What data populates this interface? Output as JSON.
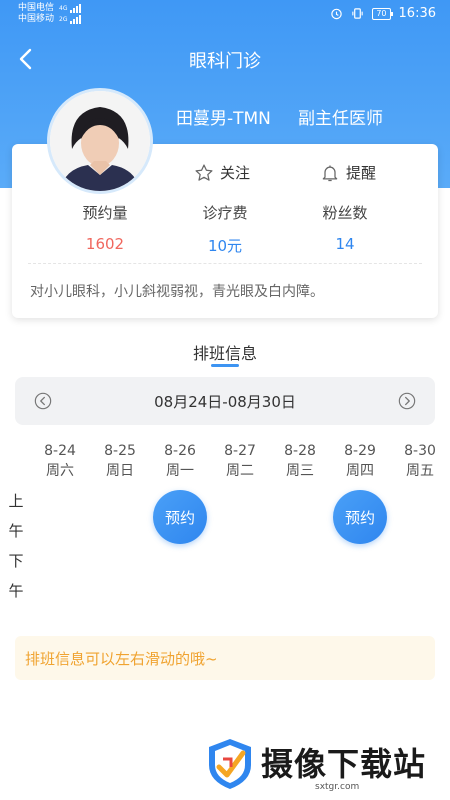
{
  "status_bar": {
    "carrier1": "中国电信",
    "carrier1_net": "4G",
    "carrier2": "中国移动",
    "carrier2_net": "2G",
    "battery": "70",
    "time": "16:36"
  },
  "nav": {
    "title": "眼科门诊",
    "back_icon": "chevron-left-icon"
  },
  "doctor": {
    "name": "田蔓男-TMN",
    "title": "副主任医师",
    "follow_label": "关注",
    "remind_label": "提醒",
    "stats": [
      {
        "label": "预约量",
        "value": "1602",
        "color": "#f0675e"
      },
      {
        "label": "诊疗费",
        "value": "10元",
        "color": "#2f86ef"
      },
      {
        "label": "粉丝数",
        "value": "14",
        "color": "#2f86ef"
      }
    ],
    "description": "对小儿眼科，小儿斜视弱视，青光眼及白内障。"
  },
  "schedule": {
    "title": "排班信息",
    "week_range": "08月24日-08月30日",
    "days": [
      {
        "date": "8-24",
        "weekday": "周六"
      },
      {
        "date": "8-25",
        "weekday": "周日"
      },
      {
        "date": "8-26",
        "weekday": "周一"
      },
      {
        "date": "8-27",
        "weekday": "周二"
      },
      {
        "date": "8-28",
        "weekday": "周三"
      },
      {
        "date": "8-29",
        "weekday": "周四"
      },
      {
        "date": "8-30",
        "weekday": "周五"
      }
    ],
    "morning": [
      "上",
      "午"
    ],
    "afternoon": [
      "下",
      "午"
    ],
    "book_label": "预约",
    "tip": "排班信息可以左右滑动的哦~"
  },
  "watermark": {
    "name": "摄像下载站",
    "url": "sxtgr.com"
  },
  "colors": {
    "primary": "#3d94f2",
    "accent_red": "#f0675e",
    "tip_orange": "#f0a330"
  }
}
